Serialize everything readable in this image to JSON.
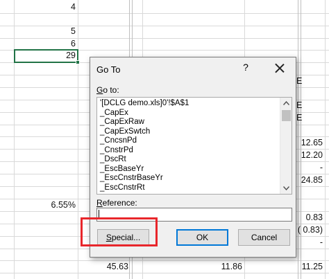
{
  "sheet": {
    "colA": [
      {
        "text": "4"
      },
      {
        "text": "5"
      },
      {
        "text": "6"
      },
      {
        "text": "29"
      },
      {
        "text": "6.55%"
      },
      {
        "text": "45.63"
      }
    ],
    "colMid": [
      {
        "text": "11.86"
      }
    ],
    "colRight": [
      {
        "text": "E"
      },
      {
        "text": "E"
      },
      {
        "text": "E"
      },
      {
        "text": "12.65"
      },
      {
        "text": "12.20"
      },
      {
        "text": "-"
      },
      {
        "text": "24.85"
      },
      {
        "text": "0.83"
      },
      {
        "text": "( 0.83)"
      },
      {
        "text": "-"
      },
      {
        "text": "11.25"
      }
    ]
  },
  "dialog": {
    "title": "Go To",
    "help": "?",
    "goto_label": "Go to:",
    "items": [
      "'[DCLG demo.xls]0'!$A$1",
      "_CapEx",
      "_CapExRaw",
      "_CapExSwtch",
      "_CncsnPd",
      "_CnstrPd",
      "_DscRt",
      "_EscBaseYr",
      "_EscCnstrBaseYr",
      "_EscCnstrRt"
    ],
    "reference_label": "Reference:",
    "reference_value": "",
    "buttons": {
      "special": "Special...",
      "ok": "OK",
      "cancel": "Cancel"
    }
  },
  "colors": {
    "highlight": "#e8262b",
    "active_cell": "#217346",
    "default_button_border": "#0078d7"
  },
  "icons": {
    "close": "close-icon",
    "scroll_up": "chevron-up-icon",
    "scroll_down": "chevron-down-icon"
  }
}
